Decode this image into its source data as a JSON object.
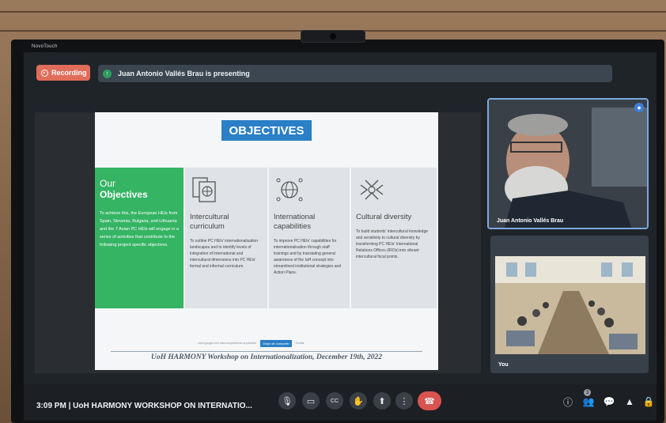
{
  "bezel": {
    "brand": "NovoTouch"
  },
  "header": {
    "recording_label": "Recording",
    "presenting_text": "Juan Antonio Vallés Brau is presenting"
  },
  "slide": {
    "title": "OBJECTIVES",
    "intro": {
      "heading_line1": "Our",
      "heading_line2": "Objectives",
      "body": "To achieve this, the European HEIs from Spain, Slovenia, Bulgaria, and Lithuania and the 7 Asian PC HEIs will engage in a series of activities that contribute to the following project specific objectives."
    },
    "columns": [
      {
        "heading": "Intercultural curriculum",
        "body": "To outline PC HEIs' internationalisation landscapes and to identify levels of integration of international and intercultural dimensions into PC HEIs' formal and informal curriculum."
      },
      {
        "heading": "International capabilities",
        "body": "To improve PC HEIs' capabilities for internationalisation through staff trainings and by translating general awareness of the IaH concept into streamlined institutional strategies and Action Plans."
      },
      {
        "heading": "Cultural diversity",
        "body": "To build students' intercultural knowledge and sensitivity to cultural diversity by transforming PC HEIs' International Relations Offices (IROs) into vibrant intercultural focal points."
      }
    ],
    "share_notice": "meet.google.com está compartiendo la pantalla.",
    "share_stop": "Dejar de compartir",
    "share_hide": "Ocultar",
    "footer": "UoH HARMONY Workshop on Internationalization, December 19th, 2022"
  },
  "participants": {
    "presenter_name": "Juan Antonio Vallés Brau",
    "self_name": "You"
  },
  "bottombar": {
    "time": "3:09 PM",
    "separator": "|",
    "meeting_title": "UoH HARMONY WORKSHOP ON INTERNATIO...",
    "people_count": "3"
  },
  "colors": {
    "recording": "#e06d5a",
    "slide_title_bg": "#2a7fc7",
    "intro_green": "#35b464",
    "end_call": "#d9534f"
  }
}
